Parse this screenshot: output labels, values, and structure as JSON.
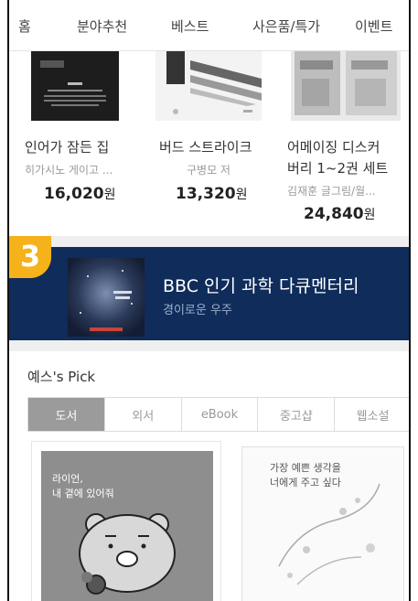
{
  "nav": {
    "items": [
      "홈",
      "분야추천",
      "베스트",
      "사은품/특가",
      "이벤트"
    ]
  },
  "books": [
    {
      "title": "인어가 잠든 집",
      "author": "히가시노 게이고 ...",
      "price": "16,020",
      "currency": "원"
    },
    {
      "title": "버드 스트라이크",
      "author": "구병모 저",
      "price": "13,320",
      "currency": "원"
    },
    {
      "title": "어메이징 디스커",
      "title2": "버리 1~2권 세트",
      "author": "김재훈 글그림/월...",
      "price": "24,840",
      "currency": "원"
    }
  ],
  "badge": "3",
  "banner": {
    "title": "BBC 인기 과학 다큐멘터리",
    "subtitle": "경이로운 우주"
  },
  "pick": {
    "title": "예스's Pick",
    "tabs": [
      "도서",
      "외서",
      "eBook",
      "중고샵",
      "웹소설"
    ],
    "active_tab": 0,
    "cards": [
      {
        "cover_text1": "라이언,",
        "cover_text2": "내 곁에 있어줘"
      },
      {
        "cover_text1": "가장 예쁜 생각을",
        "cover_text2": "너에게 주고 싶다"
      }
    ]
  }
}
